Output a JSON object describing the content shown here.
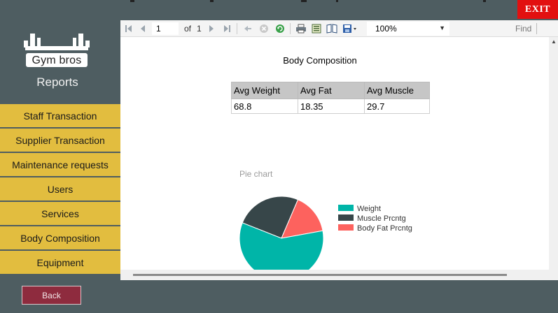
{
  "app": {
    "brand": "Gym bros",
    "section_title": "Reports"
  },
  "nav": {
    "items": [
      {
        "label": "Staff Transaction"
      },
      {
        "label": "Supplier Transaction"
      },
      {
        "label": "Maintenance requests"
      },
      {
        "label": "Users"
      },
      {
        "label": "Services"
      },
      {
        "label": "Body Composition",
        "active": true
      },
      {
        "label": "Equipment"
      }
    ],
    "back_label": "Back"
  },
  "window": {
    "exit_label": "EXIT"
  },
  "toolbar": {
    "current_page": "1",
    "of_label": "of",
    "total_pages": "1",
    "zoom": "100%",
    "find_label": "Find",
    "icons": [
      "first-page-icon",
      "prev-page-icon",
      "next-page-icon",
      "last-page-icon",
      "back-icon",
      "stop-icon",
      "refresh-icon",
      "print-icon",
      "page-layout-icon",
      "page-setup-icon",
      "export-icon"
    ]
  },
  "report": {
    "title": "Body Composition",
    "table": {
      "headers": [
        "Avg Weight",
        "Avg Fat",
        "Avg Muscle"
      ],
      "rows": [
        [
          "68.8",
          "18.35",
          "29.7"
        ]
      ]
    }
  },
  "chart_data": {
    "type": "pie",
    "title": "Pie chart",
    "series": [
      {
        "name": "Weight",
        "value": 68.8,
        "color": "#00b5a8"
      },
      {
        "name": "Muscle Prcntg",
        "value": 29.7,
        "color": "#374649"
      },
      {
        "name": "Body Fat Prcntg",
        "value": 18.35,
        "color": "#fd625e"
      }
    ],
    "legend_position": "right"
  }
}
